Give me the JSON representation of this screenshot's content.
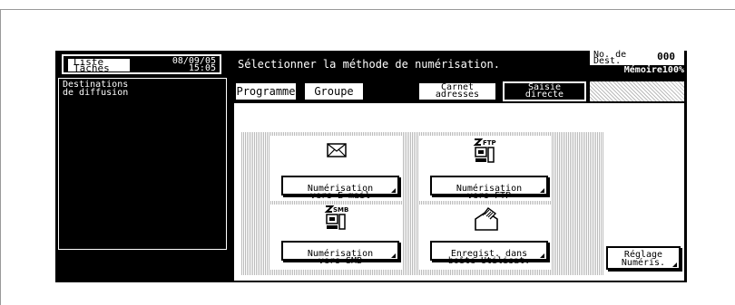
{
  "header": {
    "task_list_label": "Liste\nTâches",
    "date": "08/09/05",
    "time": "15:05",
    "instruction": "Sélectionner la méthode de numérisation.",
    "dest_label": "No. de\nDest.",
    "dest_count": "000",
    "memory": "Mémoire100%"
  },
  "sidebar": {
    "title": "Destinations\nde diffusion"
  },
  "tabs": [
    {
      "label": "Programme",
      "active": false
    },
    {
      "label": "Groupe",
      "active": false
    },
    {
      "label": "Carnet\nadresses",
      "active": false
    },
    {
      "label": "Saisie\ndirecte",
      "active": true
    }
  ],
  "functions": {
    "email": {
      "label": "Numérisation\nvers E-mail",
      "icon": "envelope-icon"
    },
    "ftp": {
      "label": "Numérisation\nvers FTP",
      "icon": "ftp-computer-icon",
      "icon_text": "FTP"
    },
    "smb": {
      "label": "Numérisation\nvers SMB",
      "icon": "smb-computer-icon",
      "icon_text": "SMB"
    },
    "box": {
      "label": "Enregist. dans\nboîte Utilisat.",
      "icon": "user-box-icon"
    }
  },
  "settings_button": {
    "label": "Réglage\nNuméris."
  },
  "colors": {
    "screen": "#000000",
    "panel": "#ffffff",
    "pattern": "#bbbbbb"
  }
}
